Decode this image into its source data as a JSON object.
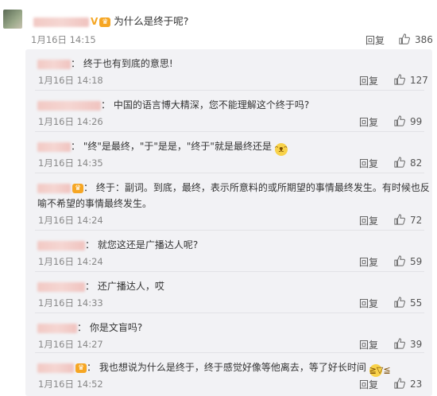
{
  "main_comment": {
    "text": "为什么是终于呢?",
    "time": "1月16日 14:15",
    "reply": "回复",
    "likes": "386"
  },
  "replies": [
    {
      "text": "终于也有到底的意思!",
      "time": "1月16日 14:18",
      "reply": "回复",
      "likes": "127"
    },
    {
      "text": "中国的语言博大精深，您不能理解这个终于吗?",
      "time": "1月16日 14:26",
      "reply": "回复",
      "likes": "99"
    },
    {
      "text": "\"终\"是最终，\"于\"是是，\"终于\"就是最终还是",
      "time": "1月16日 14:35",
      "reply": "回复",
      "likes": "82"
    },
    {
      "text": "终于：副词。到底，最终，表示所意料的或所期望的事情最终发生。有时候也反",
      "text2": "喻不希望的事情最终发生。",
      "time": "1月16日 14:24",
      "reply": "回复",
      "likes": "72"
    },
    {
      "text": "就您这还是广播达人呢?",
      "time": "1月16日 14:24",
      "reply": "回复",
      "likes": "59"
    },
    {
      "text": "还广播达人，哎",
      "time": "1月16日 14:33",
      "reply": "回复",
      "likes": "55"
    },
    {
      "text": "你是文盲吗?",
      "time": "1月16日 14:27",
      "reply": "回复",
      "likes": "39"
    },
    {
      "text": "我也想说为什么是终于，终于感觉好像等他离去，等了好长时间",
      "time": "1月16日 14:52",
      "reply": "回复",
      "likes": "23"
    }
  ],
  "icons": {
    "like": "thumbs-up-icon",
    "vip": "crown-icon",
    "verified": "v-badge-icon"
  },
  "colors": {
    "background": "#ffffff",
    "reply_panel": "#f2f2f5",
    "accent_badge": "#f6a623"
  }
}
